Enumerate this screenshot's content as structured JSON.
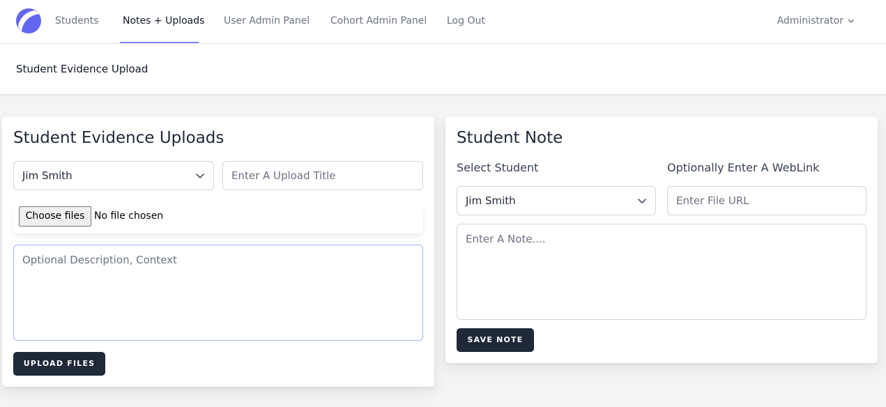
{
  "nav": {
    "links": [
      "Students",
      "Notes + Uploads",
      "User Admin Panel",
      "Cohort Admin Panel",
      "Log Out"
    ],
    "active_link": "Notes + Uploads",
    "user": "Administrator"
  },
  "page": {
    "title": "Student Evidence Upload"
  },
  "uploads": {
    "title": "Student Evidence Uploads",
    "student_select_value": "Jim Smith",
    "upload_title_placeholder": "Enter A Upload Title",
    "choose_files_label": "Choose files",
    "file_status": "No file chosen",
    "description_placeholder": "Optional Description, Context",
    "submit_label": "UPLOAD FILES"
  },
  "note": {
    "title": "Student Note",
    "select_label": "Select Student",
    "weblink_label": "Optionally Enter A WebLink",
    "student_select_value": "Jim Smith",
    "url_placeholder": "Enter File URL",
    "note_placeholder": "Enter A Note....",
    "submit_label": "SAVE NOTE"
  },
  "colors": {
    "accent": "#6366f1",
    "active_underline": "#818cf8",
    "button_dark": "#1f2937"
  },
  "icons": [
    "app-logo-icon",
    "chevron-down-icon"
  ]
}
